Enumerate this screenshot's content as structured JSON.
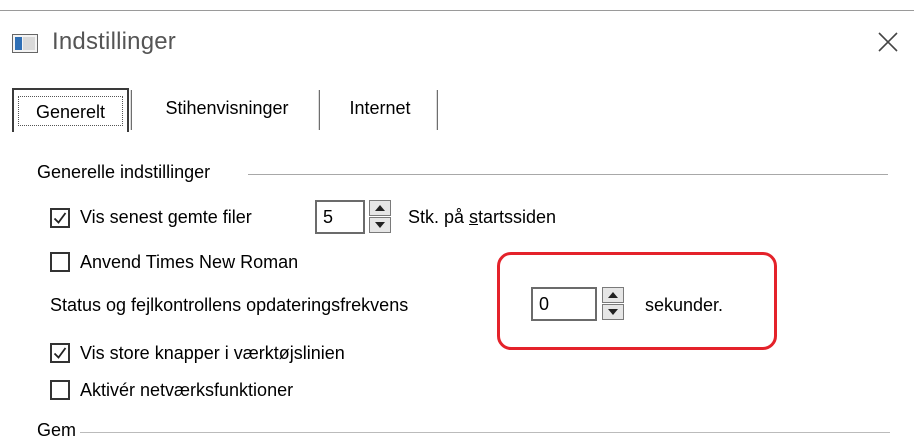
{
  "window": {
    "title": "Indstillinger"
  },
  "tabs": [
    {
      "label": "Generelt",
      "active": true
    },
    {
      "label": "Stihenvisninger",
      "active": false
    },
    {
      "label": "Internet",
      "active": false
    }
  ],
  "group": {
    "label": "Generelle indstillinger",
    "recent_files": {
      "checked": true,
      "label": "Vis senest gemte filer",
      "value": "5",
      "suffix_pre": "Stk. på ",
      "suffix_accel": "s",
      "suffix_post": "tartssiden"
    },
    "times_new_roman": {
      "checked": false,
      "label": "Anvend Times New Roman"
    },
    "status_frequency": {
      "label": "Status og fejlkontrollens opdateringsfrekvens",
      "value": "0",
      "unit": "sekunder."
    },
    "big_buttons": {
      "checked": true,
      "label": "Vis store knapper i værktøjslinien"
    },
    "network": {
      "checked": false,
      "label": "Aktivér netværksfunktioner"
    }
  },
  "next_section_partial": "Gem",
  "colors": {
    "highlight": "#e4222a"
  }
}
